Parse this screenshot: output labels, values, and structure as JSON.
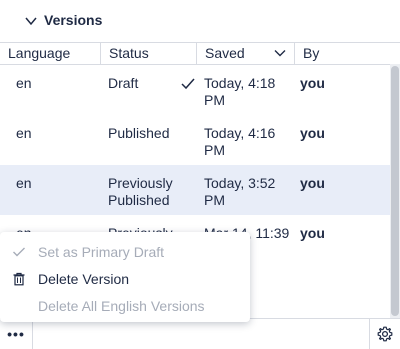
{
  "header": {
    "title": "Versions"
  },
  "columns": {
    "language": "Language",
    "status": "Status",
    "saved": "Saved",
    "by": "By"
  },
  "rows": [
    {
      "language": "en",
      "status": "Draft",
      "saved": "Today, 4:18 PM",
      "by": "you",
      "checked": true
    },
    {
      "language": "en",
      "status": "Published",
      "saved": "Today, 4:16 PM",
      "by": "you"
    },
    {
      "language": "en",
      "status": "Previously Published",
      "saved": "Today, 3:52 PM",
      "by": "you",
      "selected": true
    },
    {
      "language": "en",
      "status": "Previously",
      "saved": "Mar 14, 11:39",
      "by": "you"
    }
  ],
  "menu": {
    "items": [
      {
        "label": "Set as Primary Draft",
        "icon": "check-icon",
        "disabled": true
      },
      {
        "label": "Delete Version",
        "icon": "trash-icon",
        "disabled": false
      },
      {
        "label": "Delete All English Versions",
        "icon": "",
        "disabled": true
      }
    ]
  },
  "footer": {
    "more_label": "•••"
  },
  "colors": {
    "text": "#1f2a44",
    "selected_row": "#e8edf8",
    "disabled": "#a6acb8"
  }
}
